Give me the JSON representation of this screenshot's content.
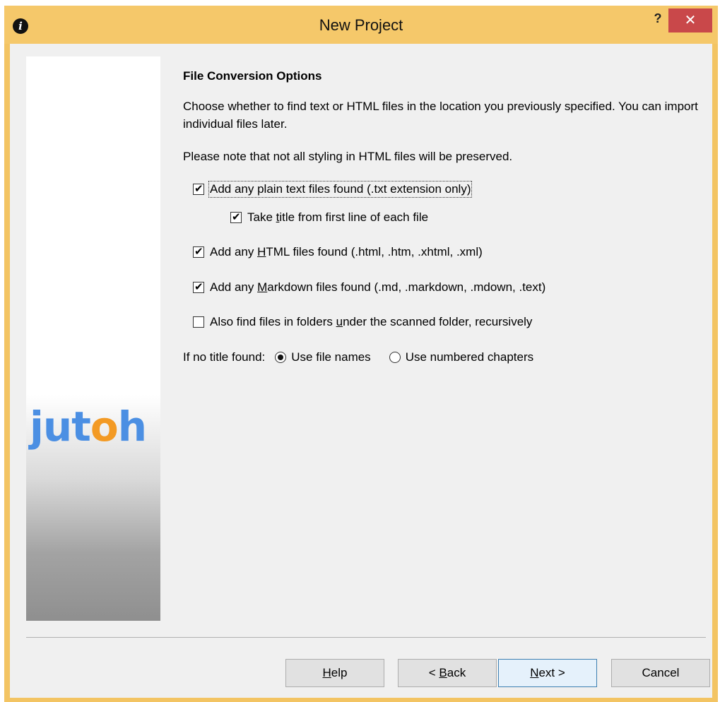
{
  "window": {
    "title": "New Project",
    "help_label": "?",
    "close_label": "✕"
  },
  "sidebar": {
    "logo_main": "jut",
    "logo_accent": "o",
    "logo_end": "h"
  },
  "page": {
    "heading": "File Conversion Options",
    "intro": "Choose whether to find text or HTML files in the location you previously specified. You can import individual files later.",
    "note": "Please note that not all styling in HTML files will be preserved."
  },
  "options": {
    "plain_text": {
      "label": "Add any plain text files found (.txt extension only)",
      "checked": true
    },
    "take_title": {
      "pre": "Take ",
      "ul": "t",
      "post": "itle from first line of each file",
      "checked": true
    },
    "html": {
      "pre": "Add any ",
      "ul": "H",
      "post": "TML files found (.html, .htm, .xhtml, .xml)",
      "checked": true
    },
    "markdown": {
      "pre": "Add any ",
      "ul": "M",
      "post": "arkdown files found (.md, .markdown, .mdown, .text)",
      "checked": true
    },
    "recursive": {
      "pre": "Also find files in folders ",
      "ul": "u",
      "post": "nder the scanned folder, recursively",
      "checked": false
    }
  },
  "no_title": {
    "label": "If no title found:",
    "file_names": "Use file names",
    "numbered": "Use numbered chapters",
    "selected": "file_names"
  },
  "buttons": {
    "help": {
      "ul": "H",
      "post": "elp"
    },
    "back": {
      "pre": "< ",
      "ul": "B",
      "post": "ack"
    },
    "next": {
      "ul": "N",
      "post": "ext >"
    },
    "cancel": "Cancel"
  }
}
